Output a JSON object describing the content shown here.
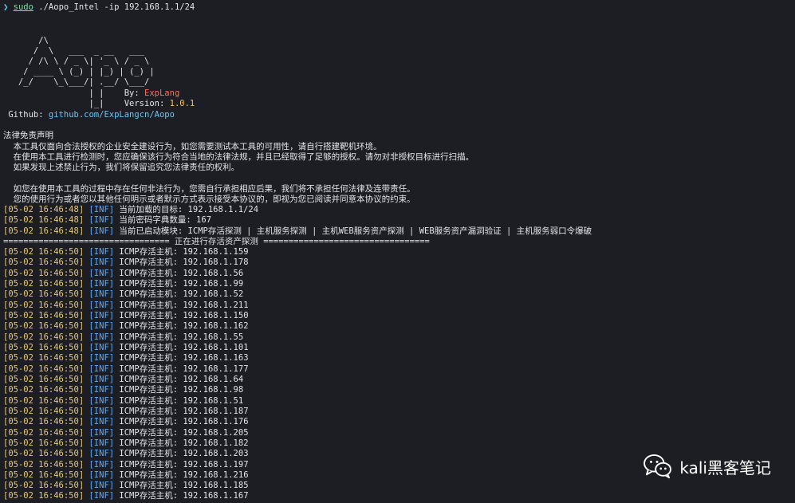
{
  "command": {
    "prompt": "❯",
    "sudo": "sudo",
    "args": "./Aopo_Intel -ip 192.168.1.1/24"
  },
  "banner": {
    "art": [
      "       /\\",
      "      /  \\   ___  _ __   ___",
      "     / /\\ \\ / _ \\| '_ \\ / _ \\",
      "    / ____ \\ (_) | |_) | (_) |",
      "   /_/    \\_\\___/| .__/ \\___/",
      "                 | |    ",
      "                 |_|    "
    ],
    "by_label": "By: ",
    "author": "ExpLang",
    "version_label": "Version: ",
    "version": "1.0.1",
    "github_label": " Github: ",
    "github_url": "github.com/ExpLangcn/Aopo"
  },
  "disclaimer": {
    "title": "法律免责声明",
    "lines": [
      "  本工具仅面向合法授权的企业安全建设行为，如您需要测试本工具的可用性，请自行搭建靶机环境。",
      "  在使用本工具进行检测时，您应确保该行为符合当地的法律法规，并且已经取得了足够的授权。请勿对非授权目标进行扫描。",
      "  如果发现上述禁止行为，我们将保留追究您法律责任的权利。",
      "",
      "  如您在使用本工具的过程中存在任何非法行为，您需自行承担相应后果，我们将不承担任何法律及连带责任。",
      "  您的使用行为或者您以其他任何明示或者默示方式表示接受本协议的，即视为您已阅读并同意本协议的约束。"
    ]
  },
  "info_lines": [
    {
      "ts": "[05-02 16:46:48]",
      "tag": "[INF]",
      "msg": " 当前加载的目标: 192.168.1.1/24"
    },
    {
      "ts": "[05-02 16:46:48]",
      "tag": "[INF]",
      "msg": " 当前密码字典数量: 167"
    },
    {
      "ts": "[05-02 16:46:48]",
      "tag": "[INF]",
      "msg": " 当前已启动模块: ICMP存活探测 | 主机服务探测 | 主机WEB服务资产探测 | WEB服务资产漏洞验证 | 主机服务弱口令爆破"
    }
  ],
  "separator": "================================= 正在进行存活资产探测 =================================",
  "host_lines": [
    {
      "ts": "[05-02 16:46:50]",
      "tag": "[INF]",
      "msg": " ICMP存活主机: 192.168.1.159"
    },
    {
      "ts": "[05-02 16:46:50]",
      "tag": "[INF]",
      "msg": " ICMP存活主机: 192.168.1.178"
    },
    {
      "ts": "[05-02 16:46:50]",
      "tag": "[INF]",
      "msg": " ICMP存活主机: 192.168.1.56"
    },
    {
      "ts": "[05-02 16:46:50]",
      "tag": "[INF]",
      "msg": " ICMP存活主机: 192.168.1.99"
    },
    {
      "ts": "[05-02 16:46:50]",
      "tag": "[INF]",
      "msg": " ICMP存活主机: 192.168.1.52"
    },
    {
      "ts": "[05-02 16:46:50]",
      "tag": "[INF]",
      "msg": " ICMP存活主机: 192.168.1.211"
    },
    {
      "ts": "[05-02 16:46:50]",
      "tag": "[INF]",
      "msg": " ICMP存活主机: 192.168.1.150"
    },
    {
      "ts": "[05-02 16:46:50]",
      "tag": "[INF]",
      "msg": " ICMP存活主机: 192.168.1.162"
    },
    {
      "ts": "[05-02 16:46:50]",
      "tag": "[INF]",
      "msg": " ICMP存活主机: 192.168.1.55"
    },
    {
      "ts": "[05-02 16:46:50]",
      "tag": "[INF]",
      "msg": " ICMP存活主机: 192.168.1.101"
    },
    {
      "ts": "[05-02 16:46:50]",
      "tag": "[INF]",
      "msg": " ICMP存活主机: 192.168.1.163"
    },
    {
      "ts": "[05-02 16:46:50]",
      "tag": "[INF]",
      "msg": " ICMP存活主机: 192.168.1.177"
    },
    {
      "ts": "[05-02 16:46:50]",
      "tag": "[INF]",
      "msg": " ICMP存活主机: 192.168.1.64"
    },
    {
      "ts": "[05-02 16:46:50]",
      "tag": "[INF]",
      "msg": " ICMP存活主机: 192.168.1.98"
    },
    {
      "ts": "[05-02 16:46:50]",
      "tag": "[INF]",
      "msg": " ICMP存活主机: 192.168.1.51"
    },
    {
      "ts": "[05-02 16:46:50]",
      "tag": "[INF]",
      "msg": " ICMP存活主机: 192.168.1.187"
    },
    {
      "ts": "[05-02 16:46:50]",
      "tag": "[INF]",
      "msg": " ICMP存活主机: 192.168.1.176"
    },
    {
      "ts": "[05-02 16:46:50]",
      "tag": "[INF]",
      "msg": " ICMP存活主机: 192.168.1.205"
    },
    {
      "ts": "[05-02 16:46:50]",
      "tag": "[INF]",
      "msg": " ICMP存活主机: 192.168.1.182"
    },
    {
      "ts": "[05-02 16:46:50]",
      "tag": "[INF]",
      "msg": " ICMP存活主机: 192.168.1.203"
    },
    {
      "ts": "[05-02 16:46:50]",
      "tag": "[INF]",
      "msg": " ICMP存活主机: 192.168.1.197"
    },
    {
      "ts": "[05-02 16:46:50]",
      "tag": "[INF]",
      "msg": " ICMP存活主机: 192.168.1.216"
    },
    {
      "ts": "[05-02 16:46:50]",
      "tag": "[INF]",
      "msg": " ICMP存活主机: 192.168.1.185"
    },
    {
      "ts": "[05-02 16:46:50]",
      "tag": "[INF]",
      "msg": " ICMP存活主机: 192.168.1.167"
    }
  ],
  "watermark": {
    "icon": "wechat-icon",
    "text": "kali黑客笔记"
  },
  "colors": {
    "background": "#1c1e24",
    "timestamp": "#e6c77a",
    "tag": "#5aa9ff",
    "author": "#ff6b5e",
    "link": "#6ec6f2"
  }
}
